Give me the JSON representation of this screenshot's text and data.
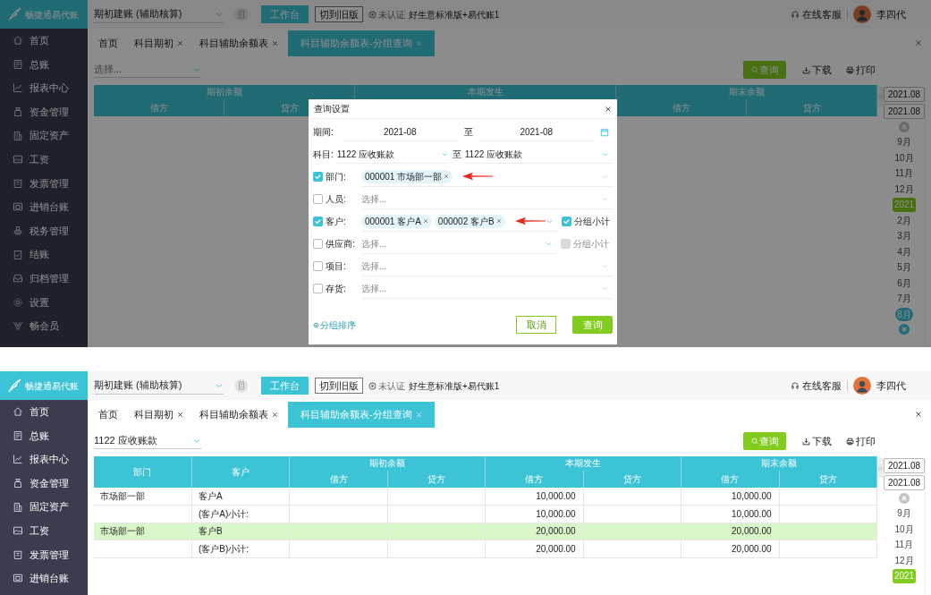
{
  "panels": [
    {
      "logo": "畅捷通易代账",
      "sidebar": {
        "items": [
          "首页",
          "总账",
          "报表中心",
          "资金管理",
          "固定资产",
          "工资",
          "发票管理",
          "进销台账",
          "税务管理",
          "结账",
          "归档管理",
          "设置",
          "畅会员"
        ]
      },
      "account_select": "期初建账 (辅助核算)",
      "workbench_button": "工作台",
      "old_version_button": "切到旧版",
      "certification": {
        "status": "未认证",
        "plan": "好生意标准版+易代账1"
      },
      "support": "在线客服",
      "user": "李四代",
      "tabs": [
        {
          "label": "首页",
          "closable": false,
          "selected": false
        },
        {
          "label": "科目期初",
          "closable": true,
          "selected": false
        },
        {
          "label": "科目辅助余额表",
          "closable": true,
          "selected": false
        },
        {
          "label": "科目辅助余额表-分组查询",
          "closable": true,
          "selected": true
        }
      ],
      "subject_filter": {
        "placeholder": "选择..."
      },
      "actions": [
        {
          "label": "查询",
          "kind": "primary"
        },
        {
          "label": "下载",
          "kind": "download"
        },
        {
          "label": "打印",
          "kind": "print"
        }
      ],
      "table": {
        "groups": [
          {
            "label": "期初余额",
            "columns": [
              "借方",
              "贷方"
            ]
          },
          {
            "label": "本期发生"
          },
          {
            "label": "期末余额",
            "columns": [
              "借方",
              "贷方"
            ]
          }
        ]
      },
      "period_rail": {
        "from": "2021.08",
        "to": "2021.08",
        "items": [
          {
            "label": "9月",
            "kind": "month",
            "selected": false
          },
          {
            "label": "10月",
            "kind": "month",
            "selected": false
          },
          {
            "label": "11月",
            "kind": "month",
            "selected": false
          },
          {
            "label": "12月",
            "kind": "month",
            "selected": false
          },
          {
            "label": "2021",
            "kind": "year",
            "selected": false
          },
          {
            "label": "2月",
            "kind": "month",
            "selected": false
          },
          {
            "label": "3月",
            "kind": "month",
            "selected": false
          },
          {
            "label": "4月",
            "kind": "month",
            "selected": false
          },
          {
            "label": "5月",
            "kind": "month",
            "selected": false
          },
          {
            "label": "6月",
            "kind": "month",
            "selected": false
          },
          {
            "label": "7月",
            "kind": "month",
            "selected": false
          },
          {
            "label": "8月",
            "kind": "month",
            "selected": true
          }
        ]
      },
      "dialog": {
        "title": "查询设置",
        "period": {
          "label": "期间:",
          "from": "2021-08",
          "sep": "至",
          "to": "2021-08"
        },
        "subject": {
          "label": "科目:",
          "from": "1122 应收账款",
          "sep": "至",
          "to": "1122 应收账款"
        },
        "filters": [
          {
            "label": "部门:",
            "checked": true,
            "tags": [
              "000001 市场部一部"
            ],
            "arrow": true
          },
          {
            "label": "人员:",
            "checked": false,
            "placeholder": "选择..."
          },
          {
            "label": "客户:",
            "checked": true,
            "tags": [
              "000001 客户A",
              "000002 客户B"
            ],
            "arrow": true,
            "subtotal": {
              "label": "分组小计",
              "checked": true,
              "disabled": false
            }
          },
          {
            "label": "供应商:",
            "checked": false,
            "placeholder": "选择...",
            "subtotal": {
              "label": "分组小计",
              "checked": false,
              "disabled": true
            }
          },
          {
            "label": "项目:",
            "checked": false,
            "placeholder": "选择..."
          },
          {
            "label": "存货:",
            "checked": false,
            "placeholder": "选择..."
          }
        ],
        "sort_link": "分组排序",
        "buttons": [
          {
            "label": "取消",
            "kind": "secondary"
          },
          {
            "label": "查询",
            "kind": "primary"
          }
        ]
      }
    },
    {
      "logo": "畅捷通易代账",
      "sidebar": {
        "items": [
          "首页",
          "总账",
          "报表中心",
          "资金管理",
          "固定资产",
          "工资",
          "发票管理",
          "进销台账"
        ]
      },
      "account_select": "期初建账 (辅助核算)",
      "workbench_button": "工作台",
      "old_version_button": "切到旧版",
      "certification": {
        "status": "未认证",
        "plan": "好生意标准版+易代账1"
      },
      "support": "在线客服",
      "user": "李四代",
      "tabs": [
        {
          "label": "首页",
          "closable": false,
          "selected": false
        },
        {
          "label": "科目期初",
          "closable": true,
          "selected": false
        },
        {
          "label": "科目辅助余额表",
          "closable": true,
          "selected": false
        },
        {
          "label": "科目辅助余额表-分组查询",
          "closable": true,
          "selected": true
        }
      ],
      "subject_filter": {
        "value": "1122 应收账款"
      },
      "actions": [
        {
          "label": "查询",
          "kind": "primary"
        },
        {
          "label": "下载",
          "kind": "download"
        },
        {
          "label": "打印",
          "kind": "print"
        }
      ],
      "table": {
        "row_headers": [
          "部门",
          "客户"
        ],
        "groups": [
          {
            "label": "期初余额",
            "columns": [
              "借方",
              "贷方"
            ]
          },
          {
            "label": "本期发生",
            "columns": [
              "借方",
              "贷方"
            ]
          },
          {
            "label": "期末余额",
            "columns": [
              "借方",
              "贷方"
            ]
          }
        ],
        "rows": [
          {
            "cells": [
              "市场部一部",
              "客户A",
              null,
              null,
              "10,000.00",
              null,
              "10,000.00",
              null
            ],
            "selected": false
          },
          {
            "cells": [
              null,
              "(客户A)小计:",
              null,
              null,
              "10,000.00",
              null,
              "10,000.00",
              null
            ],
            "selected": false
          },
          {
            "cells": [
              "市场部一部",
              "客户B",
              null,
              null,
              "20,000.00",
              null,
              "20,000.00",
              null
            ],
            "selected": true
          },
          {
            "cells": [
              null,
              "(客户B)小计:",
              null,
              null,
              "20,000.00",
              null,
              "20,000.00",
              null
            ],
            "selected": false
          }
        ]
      },
      "period_rail": {
        "from": "2021.08",
        "to": "2021.08",
        "items": [
          {
            "label": "9月",
            "kind": "month",
            "selected": false
          },
          {
            "label": "10月",
            "kind": "month",
            "selected": false
          },
          {
            "label": "11月",
            "kind": "month",
            "selected": false
          },
          {
            "label": "12月",
            "kind": "month",
            "selected": false
          },
          {
            "label": "2021",
            "kind": "year",
            "selected": false
          }
        ]
      }
    }
  ]
}
